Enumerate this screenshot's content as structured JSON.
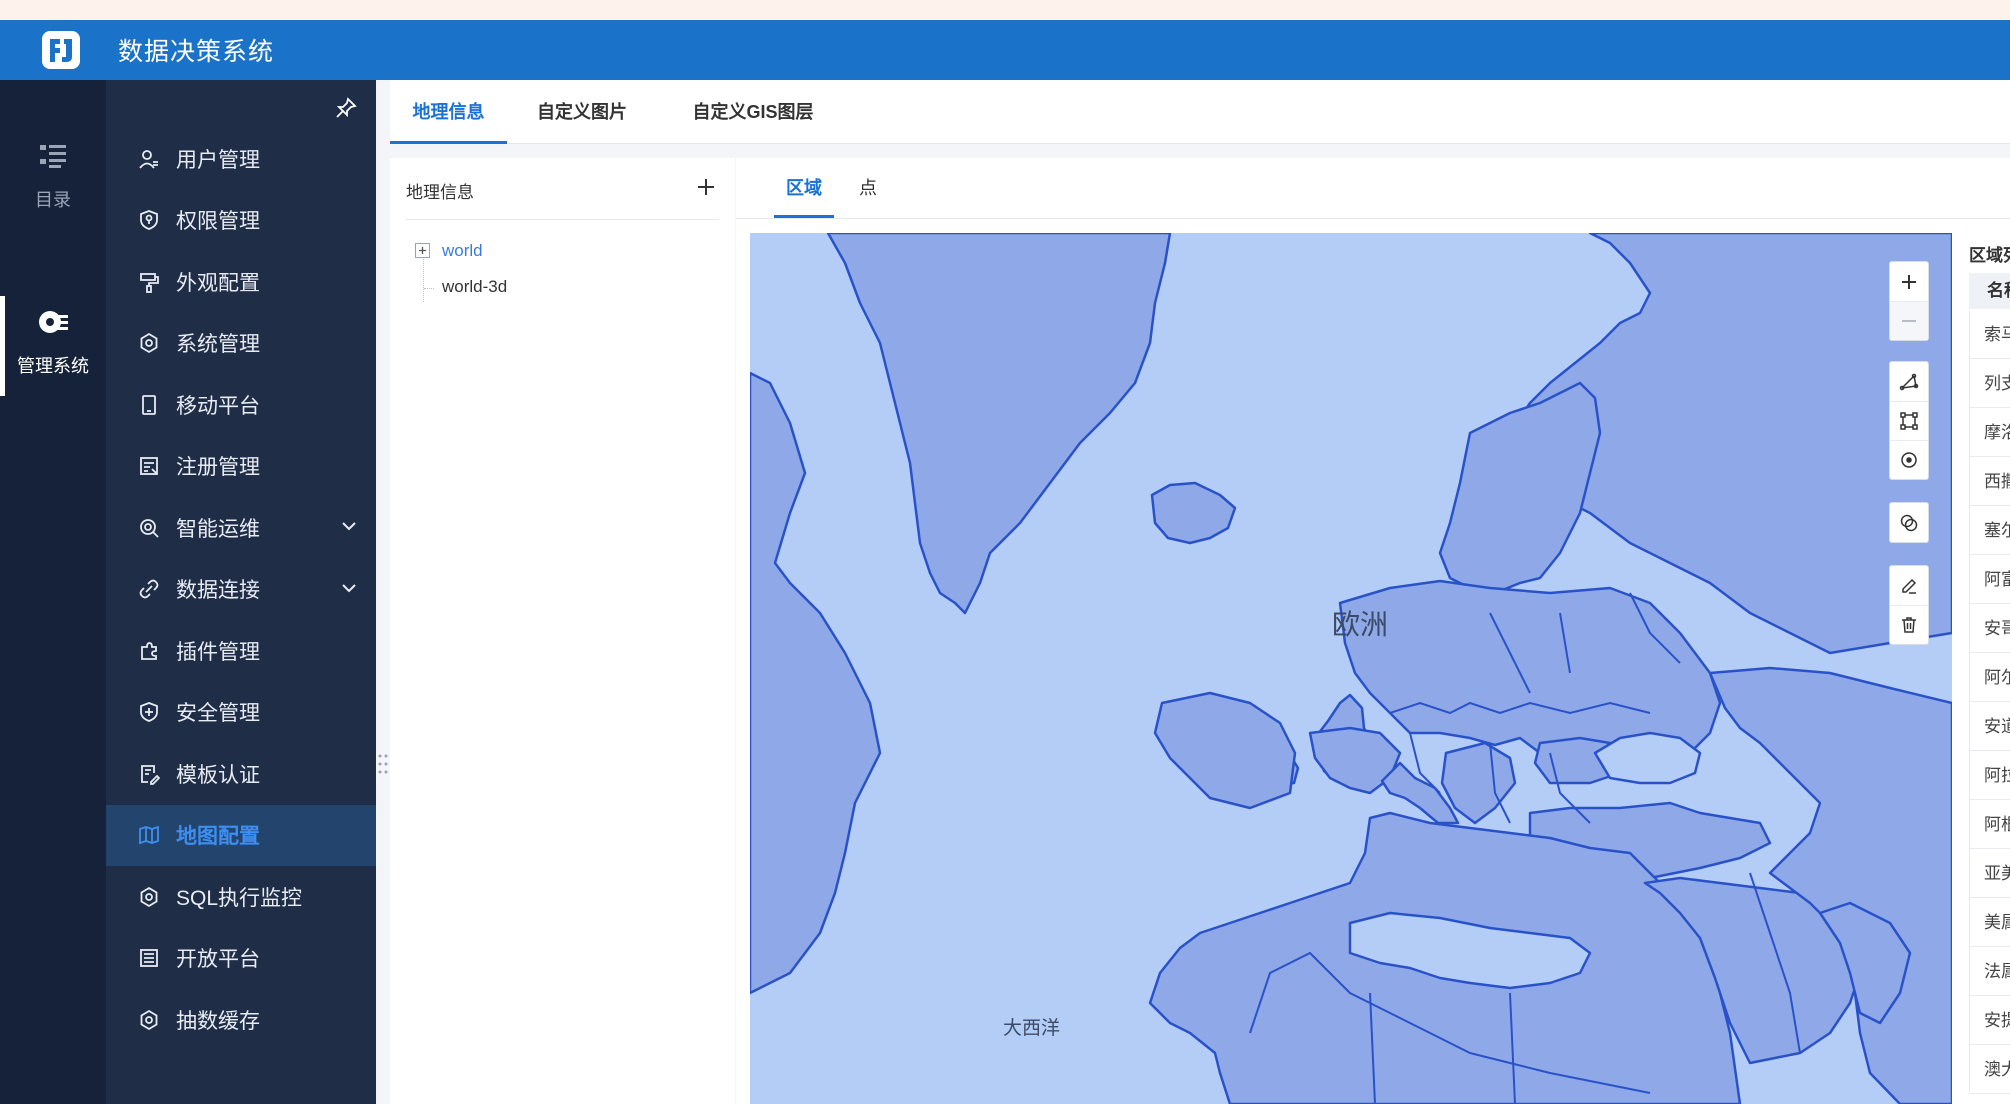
{
  "app": {
    "title": "数据决策系统"
  },
  "rail": [
    {
      "label": "目录",
      "icon": "catalog-icon"
    },
    {
      "label": "管理系统",
      "icon": "manage-system-icon"
    }
  ],
  "sidebar": {
    "items": [
      {
        "label": "用户管理",
        "icon": "user-icon"
      },
      {
        "label": "权限管理",
        "icon": "shield-key-icon"
      },
      {
        "label": "外观配置",
        "icon": "paint-roller-icon"
      },
      {
        "label": "系统管理",
        "icon": "gear-icon"
      },
      {
        "label": "移动平台",
        "icon": "mobile-icon"
      },
      {
        "label": "注册管理",
        "icon": "register-icon"
      },
      {
        "label": "智能运维",
        "icon": "ops-icon",
        "expandable": true
      },
      {
        "label": "数据连接",
        "icon": "link-icon",
        "expandable": true
      },
      {
        "label": "插件管理",
        "icon": "puzzle-icon"
      },
      {
        "label": "安全管理",
        "icon": "shield-plus-icon"
      },
      {
        "label": "模板认证",
        "icon": "template-icon"
      },
      {
        "label": "地图配置",
        "icon": "map-icon",
        "active": true
      },
      {
        "label": "SQL执行监控",
        "icon": "gear-icon"
      },
      {
        "label": "开放平台",
        "icon": "list-icon"
      },
      {
        "label": "抽数缓存",
        "icon": "gear-icon"
      }
    ]
  },
  "tabs": [
    {
      "label": "地理信息",
      "active": true
    },
    {
      "label": "自定义图片"
    },
    {
      "label": "自定义GIS图层"
    }
  ],
  "geo_panel": {
    "title": "地理信息",
    "tree": [
      {
        "label": "world",
        "selected": true
      },
      {
        "label": "world-3d"
      }
    ]
  },
  "subtabs": [
    {
      "label": "区域",
      "active": true
    },
    {
      "label": "点"
    }
  ],
  "map": {
    "labels": {
      "europe": "欧洲",
      "atlantic": "大西洋"
    },
    "colors": {
      "ocean": "#b4cdf7",
      "land": "#8fa9e8",
      "border": "#2a52c8"
    }
  },
  "region_panel": {
    "title": "区域列表",
    "column": "名称",
    "rows": [
      "索马里",
      "列支敦士登",
      "摩洛哥",
      "西撒哈拉",
      "塞尔维亚",
      "阿富汗",
      "安哥拉",
      "阿尔巴尼亚",
      "安道尔",
      "阿拉伯联合酋长国",
      "阿根廷",
      "亚美尼亚",
      "美属萨摩亚",
      "法属南部领地",
      "安提瓜和巴布达",
      "澳大利亚"
    ]
  }
}
